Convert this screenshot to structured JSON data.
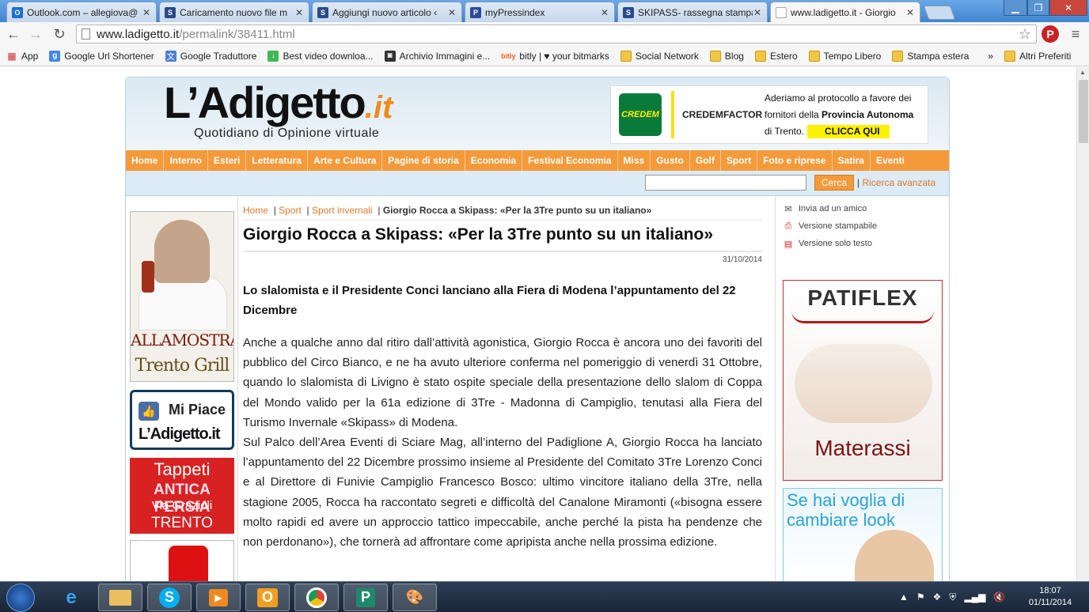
{
  "browser": {
    "tabs": [
      {
        "label": "Outlook.com – allegiova@",
        "icon": "outlook-icon",
        "color": "#1e6fd0"
      },
      {
        "label": "Caricamento nuovo file m",
        "icon": "ski-icon",
        "color": "#2a4a8a"
      },
      {
        "label": "Aggiungi nuovo articolo ‹",
        "icon": "ski-icon",
        "color": "#2a4a8a"
      },
      {
        "label": "myPressindex",
        "icon": "pi-icon",
        "color": "#2c4a9a"
      },
      {
        "label": "SKIPASS- rassegna stampa",
        "icon": "ski-icon",
        "color": "#2a4a8a"
      },
      {
        "label": "www.ladigetto.it - Giorgio",
        "icon": "page-icon",
        "color": "#cccccc"
      }
    ],
    "address": {
      "domain": "www.ladigetto.it",
      "path": "/permalink/38411.html"
    },
    "bookmarks": [
      {
        "label": "App",
        "icon": "apps-icon"
      },
      {
        "label": "Google Url Shortener",
        "icon": "google-icon"
      },
      {
        "label": "Google Traduttore",
        "icon": "translate-icon"
      },
      {
        "label": "Best video downloa...",
        "icon": "download-icon"
      },
      {
        "label": "Archivio Immagini e...",
        "icon": "camera-icon"
      },
      {
        "label": "bitly | ♥ your bitmarks",
        "icon": "bitly-icon"
      },
      {
        "label": "Social Network",
        "icon": "folder-icon"
      },
      {
        "label": "Blog",
        "icon": "folder-icon"
      },
      {
        "label": "Estero",
        "icon": "folder-icon"
      },
      {
        "label": "Tempo Libero",
        "icon": "folder-icon"
      },
      {
        "label": "Stampa estera",
        "icon": "folder-icon"
      }
    ],
    "bookmarks_more": "»",
    "bookmarks_other": "Altri Preferiti"
  },
  "site": {
    "logo_main": "L’Adigetto",
    "logo_tld": ".it",
    "logo_sub": "Quotidiano di Opinione virtuale",
    "banner": {
      "mark": "CREDEM",
      "factor": "CREDEMFACTOR",
      "line1": "Aderiamo al protocollo a favore dei",
      "line2a": "fornitori della ",
      "line2b": "Provincia Autonoma",
      "line3": "di Trento.",
      "cta": "CLICCA QUI"
    },
    "menu": [
      "Home",
      "Interno",
      "Esteri",
      "Letteratura",
      "Arte e Cultura",
      "Pagine di storia",
      "Economia",
      "Festival Economia",
      "Miss",
      "Gusto",
      "Golf",
      "Sport",
      "Foto e riprese",
      "Satira",
      "Eventi"
    ],
    "search_button": "Cerca",
    "search_sep": "|",
    "advanced_search": "Ricerca avanzata"
  },
  "ads_left": {
    "grill_t1": "ALLAMOSTRA",
    "grill_t2": "Trento Grill",
    "mipiace_l1": "Mi Piace",
    "mipiace_l2": "L’Adigetto.it",
    "tappeti_a": "Tappeti",
    "tappeti_b": "ANTICA PERSIA",
    "tappeti_c": "Via Grazioli",
    "tappeti_d": "TRENTO"
  },
  "article": {
    "breadcrumb": [
      {
        "label": "Home"
      },
      {
        "label": "Sport"
      },
      {
        "label": "Sport invernali"
      }
    ],
    "breadcrumb_sep": "|",
    "breadcrumb_current": "Giorgio Rocca a Skipass: «Per la 3Tre punto su un italiano»",
    "title": "Giorgio Rocca a Skipass: «Per la 3Tre punto su un italiano»",
    "date": "31/10/2014",
    "lead": "Lo slalomista e il Presidente Conci lanciano alla Fiera di Modena l’appuntamento del 22 Dicembre",
    "p1": "Anche a qualche anno dal ritiro dall’attività agonistica, Giorgio Rocca è ancora uno dei favoriti del pubblico del Circo Bianco, e ne ha avuto ulteriore conferma nel pomeriggio di venerdì 31 Ottobre, quando lo slalomista di Livigno è stato ospite speciale della presentazione dello slalom di Coppa del Mondo valido per la 61a edizione di 3Tre - Madonna di Campiglio, tenutasi alla Fiera del Turismo Invernale «Skipass» di Modena.",
    "p2": "Sul Palco dell’Area Eventi di Sciare Mag, all’interno del Padiglione A, Giorgio Rocca ha lanciato l’appuntamento del 22 Dicembre prossimo insieme al Presidente del Comitato 3Tre Lorenzo Conci e al Direttore di Funivie Campiglio Francesco Bosco: ultimo vincitore italiano della 3Tre, nella stagione 2005, Rocca ha raccontato segreti e difficoltà del Canalone Miramonti («bisogna essere molto rapidi ed avere un approccio tattico impeccabile, anche perché la pista ha pendenze che non perdonano»), che tornerà ad affrontare come apripista anche nella prossima edizione."
  },
  "tools": [
    {
      "label": "Invia ad un amico",
      "icon": "envelope-icon"
    },
    {
      "label": "Versione stampabile",
      "icon": "printer-icon"
    },
    {
      "label": "Versione solo testo",
      "icon": "document-icon"
    }
  ],
  "ads_right": {
    "patiflex_brand": "PATIFLEX",
    "patiflex_product": "Materassi",
    "look_text": "Se hai voglia di cambiare look"
  },
  "taskbar": {
    "time": "18:07",
    "date": "01/11/2014"
  },
  "colors": {
    "accent": "#f49a3b",
    "link": "#e0782a",
    "header_bg": "#dbe9f3"
  }
}
